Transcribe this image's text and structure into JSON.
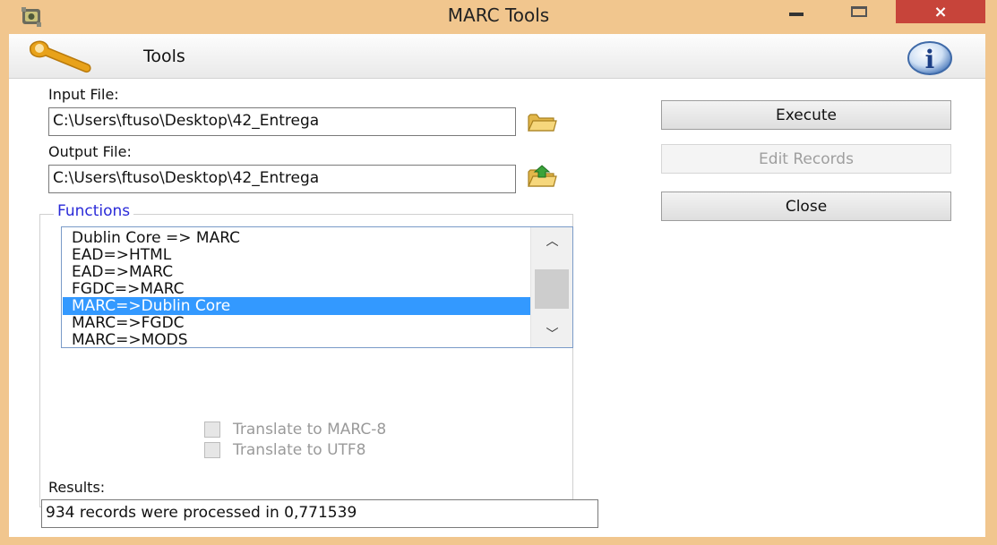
{
  "window": {
    "title": "MARC Tools",
    "icon": "marc-tools-app-icon",
    "controls": {
      "minimize": "minimize-icon",
      "maximize": "maximize-icon",
      "close": "×"
    }
  },
  "toolbar": {
    "label": "Tools",
    "left_icon": "wrench-icon",
    "right_icon": "info-icon",
    "info_glyph": "i"
  },
  "input": {
    "label": "Input File:",
    "value": "C:\\Users\\ftuso\\Desktop\\42_Entrega",
    "browse_icon": "folder-open-icon"
  },
  "output": {
    "label": "Output File:",
    "value": "C:\\Users\\ftuso\\Desktop\\42_Entrega",
    "browse_icon": "folder-save-icon"
  },
  "buttons": {
    "execute": "Execute",
    "edit_records": "Edit Records",
    "close": "Close"
  },
  "functions": {
    "title": "Functions",
    "items": [
      "Dublin Core => MARC",
      "EAD=>HTML",
      "EAD=>MARC",
      "FGDC=>MARC",
      "MARC=>Dublin Core",
      "MARC=>FGDC",
      "MARC=>MODS"
    ],
    "selected": "MARC=>Dublin Core",
    "scroll_up": "︿",
    "scroll_down": "﹀",
    "translate_marc8": "Translate to MARC-8",
    "translate_utf8": "Translate to UTF8",
    "translate_marc8_checked": false,
    "translate_utf8_checked": false
  },
  "results": {
    "label": "Results:",
    "value": "934 records were processed in 0,771539"
  },
  "colors": {
    "title_bar": "#f1c68e",
    "close_button": "#c7443a",
    "selection": "#3399ff",
    "group_title": "#2a2ad8"
  }
}
